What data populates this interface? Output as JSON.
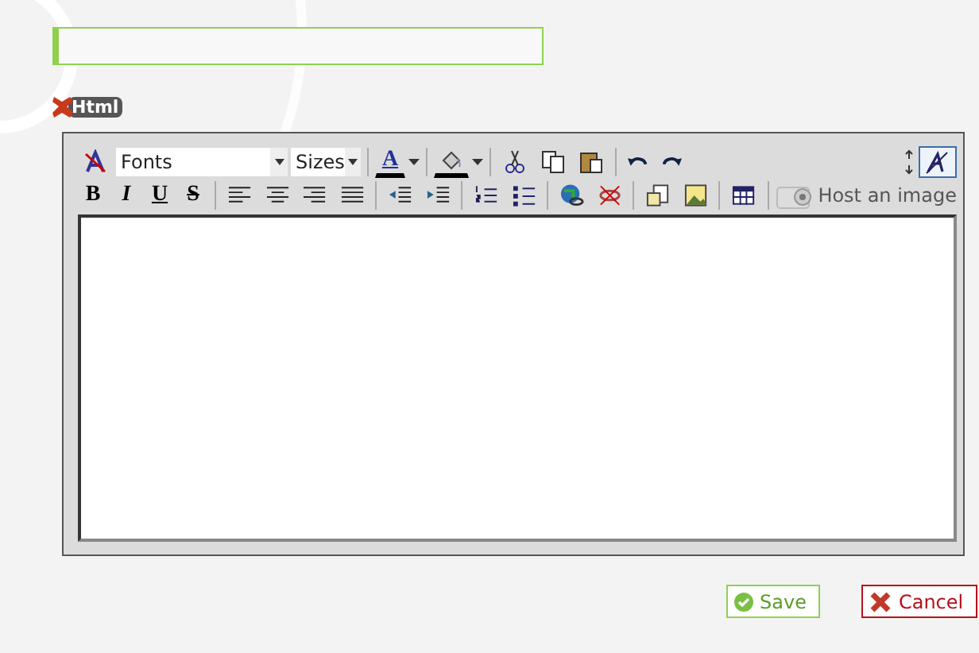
{
  "html_badge": "Html",
  "toolbar": {
    "font_select": "Fonts",
    "size_select": "Sizes",
    "font_color_letter": "A",
    "format_buttons": [
      "B",
      "I",
      "U",
      "S"
    ],
    "host_image": "Host an image",
    "source_toggle": {
      "selected": true
    }
  },
  "buttons": [
    {
      "kind": "save",
      "label": "Save"
    },
    {
      "kind": "cancel",
      "label": "Cancel"
    }
  ]
}
